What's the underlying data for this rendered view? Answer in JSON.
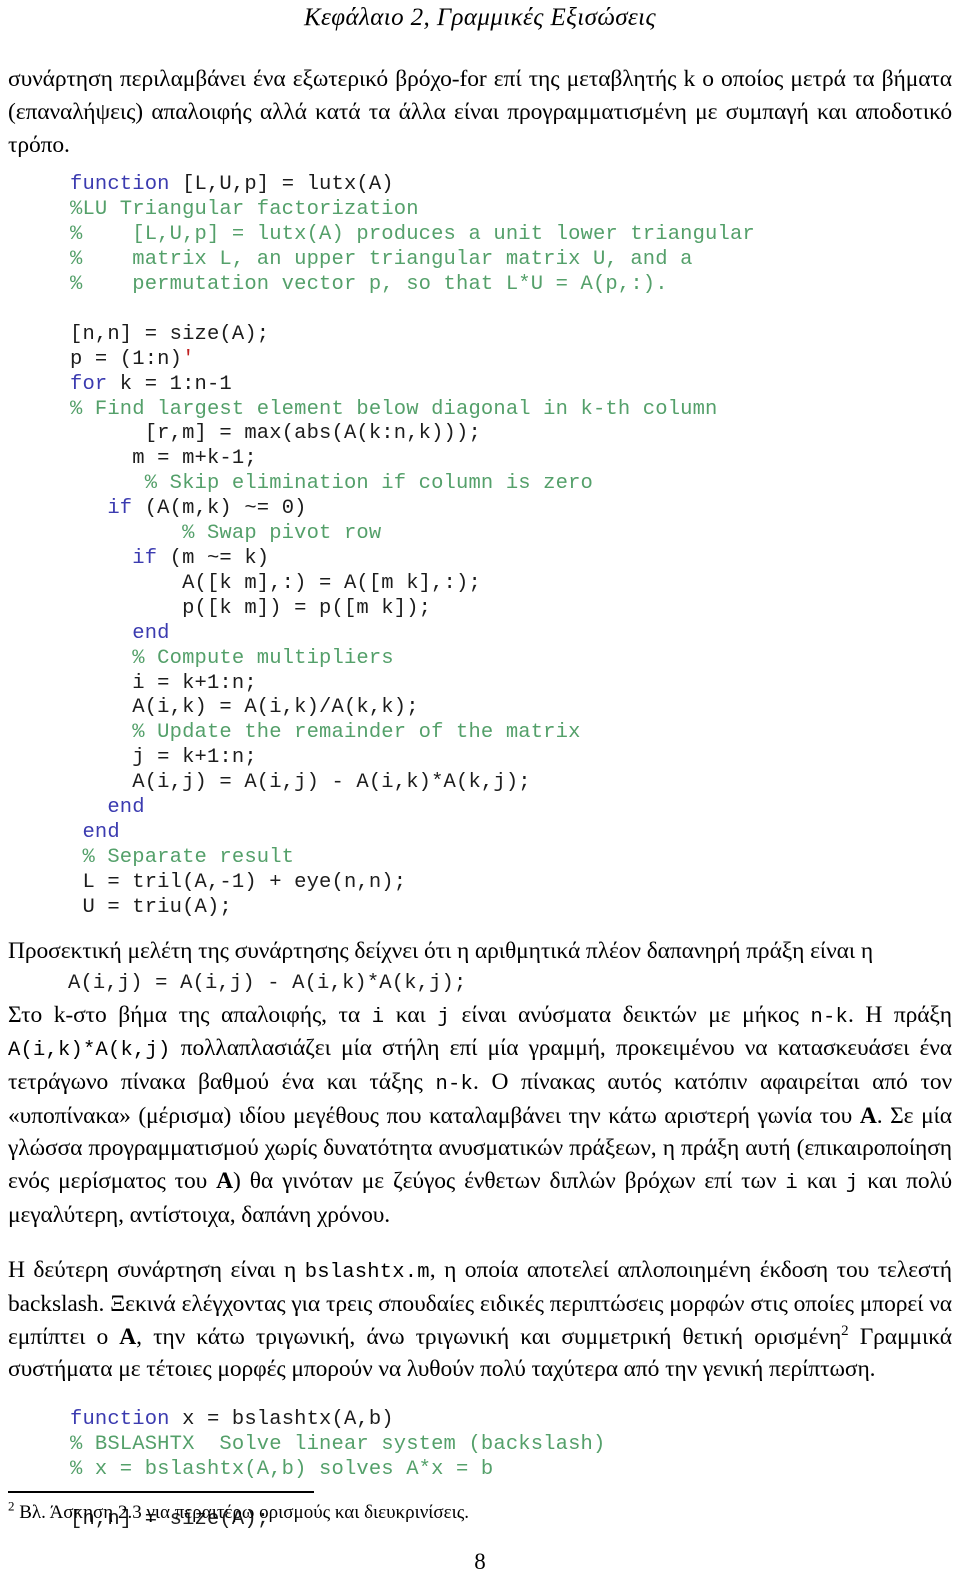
{
  "header": {
    "running_title": "Κεφάλαιο 2, Γραμμικές Εξισώσεις"
  },
  "intro_paragraph": "συνάρτηση περιλαμβάνει ένα εξωτερικό βρόχο-for επί της μεταβλητής k ο οποίος μετρά τα βήματα (επαναλήψεις) απαλοιφής αλλά κατά τα άλλα είναι προγραμματισμένη με συμπαγή και αποδοτικό τρόπο.",
  "listing_lutx": {
    "lines": [
      [
        {
          "t": "function",
          "c": "kw"
        },
        {
          "t": " [L,U,p] = lutx(A)",
          "c": "pl"
        }
      ],
      [
        {
          "t": "%LU Triangular factorization",
          "c": "cm"
        }
      ],
      [
        {
          "t": "%    [L,U,p] = lutx(A) produces a unit lower triangular",
          "c": "cm"
        }
      ],
      [
        {
          "t": "%    matrix L, an upper triangular matrix U, and a",
          "c": "cm"
        }
      ],
      [
        {
          "t": "%    permutation vector p, so that L*U = A(p,:).",
          "c": "cm"
        }
      ],
      [
        {
          "t": "",
          "c": "pl"
        }
      ],
      [
        {
          "t": "[n,n] = size(A);",
          "c": "pl"
        }
      ],
      [
        {
          "t": "p = (1:n)",
          "c": "pl"
        },
        {
          "t": "'",
          "c": "str"
        }
      ],
      [
        {
          "t": "for",
          "c": "kw"
        },
        {
          "t": " k = 1:n-1",
          "c": "pl"
        }
      ],
      [
        {
          "t": "% Find largest element below diagonal in k-th column",
          "c": "cm"
        }
      ],
      [
        {
          "t": "      [r,m] = max(abs(A(k:n,k)));",
          "c": "pl"
        }
      ],
      [
        {
          "t": "     m = m+k-1;",
          "c": "pl"
        }
      ],
      [
        {
          "t": "      % Skip elimination if column is zero",
          "c": "cm"
        }
      ],
      [
        {
          "t": "   if",
          "c": "kw"
        },
        {
          "t": " (A(m,k) ~= 0)",
          "c": "pl"
        }
      ],
      [
        {
          "t": "         % Swap pivot row",
          "c": "cm"
        }
      ],
      [
        {
          "t": "     if",
          "c": "kw"
        },
        {
          "t": " (m ~= k)",
          "c": "pl"
        }
      ],
      [
        {
          "t": "         A([k m],:) = A([m k],:);",
          "c": "pl"
        }
      ],
      [
        {
          "t": "         p([k m]) = p([m k]);",
          "c": "pl"
        }
      ],
      [
        {
          "t": "     end",
          "c": "kw"
        }
      ],
      [
        {
          "t": "     % Compute multipliers",
          "c": "cm"
        }
      ],
      [
        {
          "t": "     i = k+1:n;",
          "c": "pl"
        }
      ],
      [
        {
          "t": "     A(i,k) = A(i,k)/A(k,k);",
          "c": "pl"
        }
      ],
      [
        {
          "t": "     % Update the remainder of the matrix",
          "c": "cm"
        }
      ],
      [
        {
          "t": "     j = k+1:n;",
          "c": "pl"
        }
      ],
      [
        {
          "t": "     A(i,j) = A(i,j) - A(i,k)*A(k,j);",
          "c": "pl"
        }
      ],
      [
        {
          "t": "   end",
          "c": "kw"
        }
      ],
      [
        {
          "t": " end",
          "c": "kw"
        }
      ],
      [
        {
          "t": " % Separate result",
          "c": "cm"
        }
      ],
      [
        {
          "t": " L = tril(A,-1) + eye(n,n);",
          "c": "pl"
        }
      ],
      [
        {
          "t": " U = triu(A);",
          "c": "pl"
        }
      ]
    ]
  },
  "para_costly": {
    "lead": "Προσεκτική μελέτη της συνάρτησης δείχνει ότι η αριθμητικά πλέον δαπανηρή πράξη είναι η",
    "code_line": "A(i,j) = A(i,j) - A(i,k)*A(k,j);",
    "s1": "Στο k-στο βήμα της απαλοιφής, τα ",
    "c1": "i",
    "s2": " και ",
    "c2": "j",
    "s3": " είναι ανύσματα δεικτών με μήκος ",
    "c3": "n-k",
    "s4": ". Η πράξη ",
    "c4": "A(i,k)*A(k,j)",
    "s5": " πολλαπλασιάζει μία στήλη επί μία γραμμή, προκειμένου να κατασκευάσει ένα τετράγωνο πίνακα βαθμού ένα και τάξης ",
    "c5": "n-k",
    "s6": ". Ο πίνακας αυτός κατόπιν αφαιρείται από τον «υποπίνακα» (μέρισμα) ιδίου μεγέθους που καταλαμβάνει την κάτω αριστερή γωνία του ",
    "m1": "A",
    "s7": ". Σε μία γλώσσα προγραμματισμού χωρίς δυνατότητα ανυσματικών πράξεων, η πράξη αυτή (επικαιροποίηση ενός μερίσματος του ",
    "m2": "A",
    "s8": ") θα γινόταν με ζεύγος ένθετων διπλών βρόχων επί των ",
    "c6": "i",
    "s9": " και ",
    "c7": "j",
    "s10": " και πολύ μεγαλύτερη, αντίστοιχα, δαπάνη χρόνου."
  },
  "para_bslashtx": {
    "s1": "Η δεύτερη συνάρτηση είναι η ",
    "c1": "bslashtx.m",
    "s2": ", η οποία αποτελεί απλοποιημένη έκδοση του τελεστή backslash. Ξεκινά ελέγχοντας για τρεις σπουδαίες ειδικές περιπτώσεις μορφών στις οποίες μπορεί να εμπίπτει ο ",
    "m1": "A",
    "s3": ", την κάτω τριγωνική, άνω τριγωνική και συμμετρική θετική ορισμένη",
    "fn_marker": "2",
    "s4": " Γραμμικά συστήματα με τέτοιες μορφές μπορούν να λυθούν πολύ ταχύτερα από την γενική περίπτωση."
  },
  "listing_bslashtx": {
    "lines": [
      [
        {
          "t": "function",
          "c": "kw"
        },
        {
          "t": " x = bslashtx(A,b)",
          "c": "pl"
        }
      ],
      [
        {
          "t": "% BSLASHTX  Solve linear system (backslash)",
          "c": "cm"
        }
      ],
      [
        {
          "t": "% x = bslashtx(A,b) solves A*x = b",
          "c": "cm"
        }
      ],
      [
        {
          "t": "",
          "c": "pl"
        }
      ],
      [
        {
          "t": "[n,n] = size(A);",
          "c": "pl"
        }
      ]
    ]
  },
  "footnote": {
    "marker": "2",
    "text": "Βλ. Άσκηση 2.3 για περαιτέρω ορισμούς και διευκρινίσεις."
  },
  "page_number": "8",
  "colors": {
    "keyword": "#3b3bb0",
    "comment": "#54a06a",
    "string": "#c02020",
    "plain": "#1c1c1c",
    "text": "#000000"
  }
}
